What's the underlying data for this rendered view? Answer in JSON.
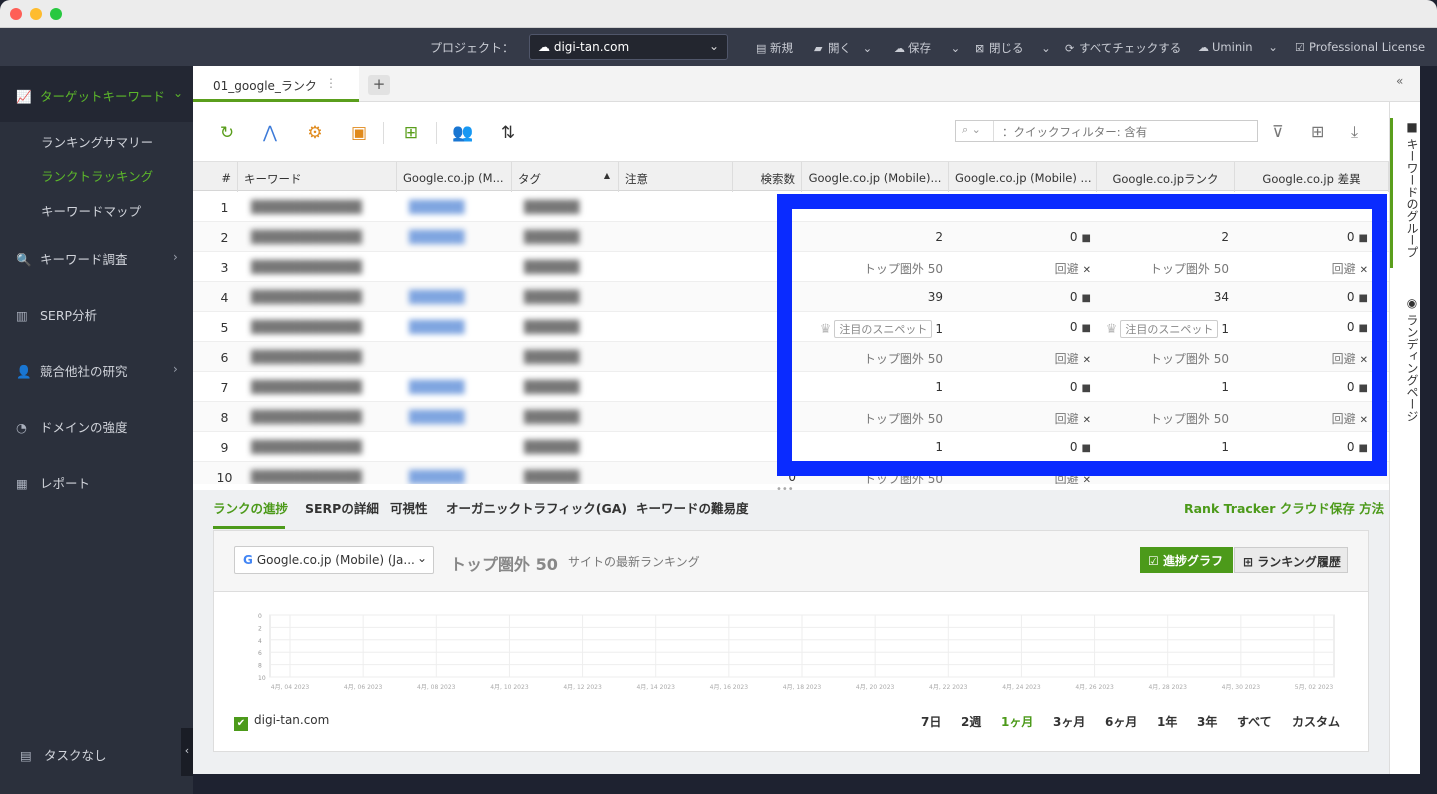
{
  "topbar": {
    "project_label": "プロジェクト：",
    "project_value": "digi-tan.com",
    "items": [
      {
        "label": "新規",
        "icon": "new-file-icon"
      },
      {
        "label": "開く",
        "icon": "open-folder-icon"
      },
      {
        "label": "保存",
        "icon": "cloud-save-icon"
      },
      {
        "label": "閉じる",
        "icon": "close-icon"
      },
      {
        "label": "すべてチェックする",
        "icon": "refresh-icon"
      },
      {
        "label": "Uminin",
        "icon": "user-icon"
      },
      {
        "label": "Professional License",
        "icon": "license-icon"
      }
    ]
  },
  "sidebar": {
    "active_section": "ターゲットキーワード",
    "sub_items": [
      "ランキングサマリー",
      "ランクトラッキング",
      "キーワードマップ"
    ],
    "sections": [
      "キーワード調査",
      "SERP分析",
      "競合他社の研究",
      "ドメインの強度",
      "レポート"
    ],
    "task_label": "タスクなし"
  },
  "tabs": {
    "active_tab": "01_google_ランク",
    "add_label": "+"
  },
  "filter": {
    "placeholder": "：クイックフィルター: 含有"
  },
  "table": {
    "headers": [
      "#",
      "キーワード",
      "Google.co.jp (M...",
      "タグ",
      "注意",
      "検索数",
      "Google.co.jp (Mobile)...",
      "Google.co.jp (Mobile) ...",
      "Google.co.jpランク",
      "Google.co.jp 差異"
    ],
    "snippet_label": "注目のスニペット",
    "rows": [
      {
        "n": "1",
        "search": "",
        "r1": "",
        "d1": "",
        "r2": "",
        "d2": ""
      },
      {
        "n": "2",
        "search": "",
        "r1": "2",
        "d1": "0",
        "r2": "2",
        "d2": "0"
      },
      {
        "n": "3",
        "search": "",
        "r1": "トップ圏外 50",
        "d1": "回避",
        "r2": "トップ圏外 50",
        "d2": "回避"
      },
      {
        "n": "4",
        "search": "",
        "r1": "39",
        "d1": "0",
        "r2": "34",
        "d2": "0"
      },
      {
        "n": "5",
        "search": "",
        "r1": "1",
        "d1": "0",
        "r2": "1",
        "d2": "0"
      },
      {
        "n": "6",
        "search": "",
        "r1": "トップ圏外 50",
        "d1": "回避",
        "r2": "トップ圏外 50",
        "d2": "回避"
      },
      {
        "n": "7",
        "search": "",
        "r1": "1",
        "d1": "0",
        "r2": "1",
        "d2": "0"
      },
      {
        "n": "8",
        "search": "",
        "r1": "トップ圏外 50",
        "d1": "回避",
        "r2": "トップ圏外 50",
        "d2": "回避"
      },
      {
        "n": "9",
        "search": "",
        "r1": "1",
        "d1": "0",
        "r2": "1",
        "d2": "0"
      },
      {
        "n": "10",
        "search": "0",
        "r1": "トップ圏外 50",
        "d1": "回避",
        "r2": "",
        "d2": ""
      }
    ]
  },
  "rail": {
    "items": [
      "キーワードのグループ",
      "ランディングページ"
    ]
  },
  "bottom": {
    "tabs": [
      "ランクの進捗",
      "SERPの詳細",
      "可視性",
      "オーガニックトラフィック(GA)",
      "キーワードの難易度"
    ],
    "rt_link": "Rank Tracker クラウド保存 方法",
    "engine": "Google.co.jp (Mobile) (Ja...",
    "rank_value": "トップ圏外 50",
    "rank_sub": "サイトの最新ランキング",
    "btn_progress": "進捗グラフ",
    "btn_history": "ランキング履歴",
    "legend_site": "digi-tan.com",
    "ranges": [
      "7日",
      "2週",
      "1ヶ月",
      "3ヶ月",
      "6ヶ月",
      "1年",
      "3年",
      "すべて",
      "カスタム"
    ],
    "active_range": "1ヶ月"
  },
  "chart_data": {
    "type": "line",
    "title": "",
    "xlabel": "",
    "ylabel": "",
    "y_ticks": [
      "0",
      "2",
      "4",
      "6",
      "8",
      "10"
    ],
    "x_ticks": [
      "4月, 04 2023",
      "4月, 06 2023",
      "4月, 08 2023",
      "4月, 10 2023",
      "4月, 12 2023",
      "4月, 14 2023",
      "4月, 16 2023",
      "4月, 18 2023",
      "4月, 20 2023",
      "4月, 22 2023",
      "4月, 24 2023",
      "4月, 26 2023",
      "4月, 28 2023",
      "4月, 30 2023",
      "5月, 02 2023"
    ],
    "series": [
      {
        "name": "digi-tan.com",
        "values": []
      }
    ]
  },
  "colors": {
    "accent": "#4c9a1a",
    "highlight": "#0a2bff"
  }
}
